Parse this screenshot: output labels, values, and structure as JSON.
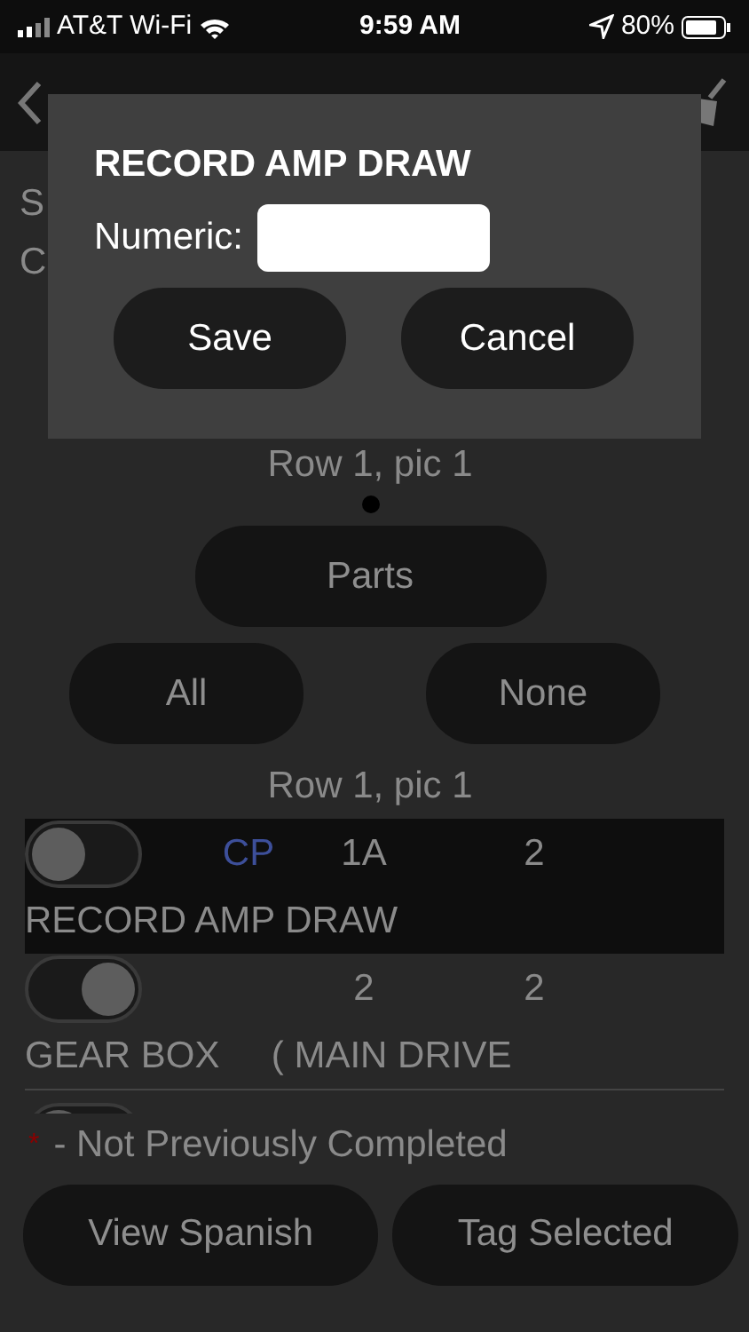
{
  "status_bar": {
    "carrier": "AT&T Wi-Fi",
    "time": "9:59 AM",
    "battery": "80%"
  },
  "header_lines": [
    "S",
    "C"
  ],
  "group_label": "Row 1, pic 1",
  "parts_button": "Parts",
  "select_buttons": [
    "All",
    "None"
  ],
  "list_label": "Row 1, pic 1",
  "rows": [
    {
      "checked": false,
      "highlighted": true,
      "code": "CP",
      "column_2": "1A",
      "column_3": "2",
      "description": "RECORD AMP DRAW"
    },
    {
      "checked": true,
      "highlighted": false,
      "column_2": "2",
      "column_3": "2",
      "description": "GEAR BOX     ( MAIN DRIVE"
    },
    {
      "checked": false,
      "highlighted": false
    }
  ],
  "legend": {
    "mark": "*",
    "text": "- Not Previously Completed"
  },
  "bottom_buttons": [
    "View Spanish",
    "Tag Selected"
  ],
  "dialog": {
    "title": "RECORD AMP DRAW",
    "field_label": "Numeric:",
    "buttons": [
      "Save",
      "Cancel"
    ]
  }
}
